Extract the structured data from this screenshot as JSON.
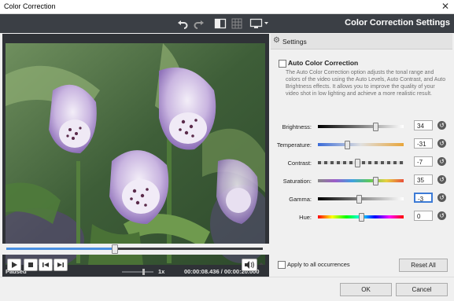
{
  "window": {
    "title": "Color Correction",
    "close_glyph": "✕"
  },
  "toolbar": {
    "heading": "Color Correction Settings",
    "icons": {
      "undo": "undo-icon",
      "redo": "redo-icon",
      "split": "split-view-icon",
      "grid": "grid-icon",
      "monitor": "monitor-icon"
    }
  },
  "player": {
    "status": "Paused",
    "speed": "1x",
    "time_current": "00:00:08.436",
    "time_separator": "/",
    "time_total": "00:00:20.000",
    "progress_fraction": 0.42
  },
  "settings": {
    "header": "Settings",
    "auto_label": "Auto Color Correction",
    "auto_checked": false,
    "description": "The Auto Color Correction option adjusts the tonal range and colors of the video using the Auto Levels, Auto Contrast, and Auto Brightness effects. It allows you to improve the quality of your video shot in low lighting and achieve a more realistic result.",
    "sliders": [
      {
        "label": "Brightness:",
        "value": "34",
        "position": 0.67
      },
      {
        "label": "Temperature:",
        "value": "-31",
        "position": 0.34
      },
      {
        "label": "Contrast:",
        "value": "-7",
        "position": 0.46
      },
      {
        "label": "Saturation:",
        "value": "35",
        "position": 0.67
      },
      {
        "label": "Gamma:",
        "value": "-3",
        "position": 0.48
      },
      {
        "label": "Hue:",
        "value": "0",
        "position": 0.5
      }
    ],
    "apply_all_label": "Apply to all occurrences",
    "reset_all": "Reset All"
  },
  "footer": {
    "ok": "OK",
    "cancel": "Cancel"
  }
}
